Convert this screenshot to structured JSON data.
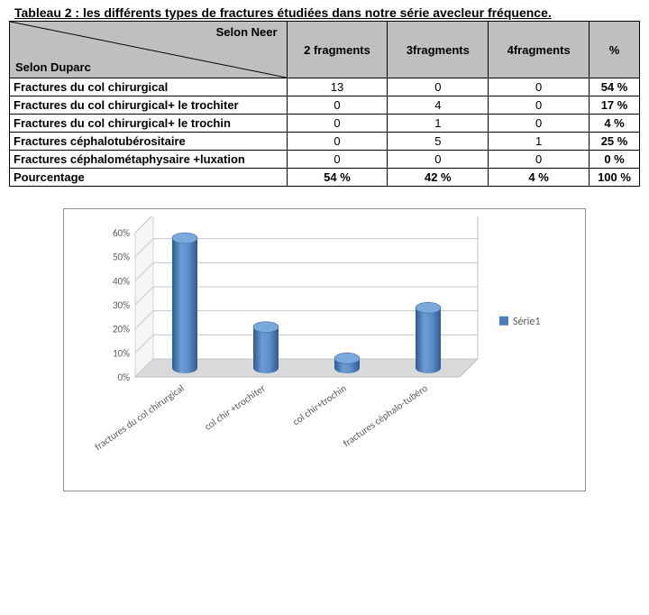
{
  "caption": "Tableau 2 :   les différents types de fractures étudiées dans notre série avecleur fréquence.",
  "table": {
    "top_axis": "Selon Neer",
    "left_axis": "Selon Duparc",
    "columns": [
      "2 fragments",
      "3fragments",
      "4fragments",
      "%"
    ],
    "rows": [
      {
        "label": "Fractures du col chirurgical",
        "cells": [
          "13",
          "0",
          "0",
          "54 %"
        ]
      },
      {
        "label": "Fractures du col chirurgical+ le trochiter",
        "cells": [
          "0",
          "4",
          "0",
          "17 %"
        ]
      },
      {
        "label": "Fractures du col chirurgical+ le trochin",
        "cells": [
          "0",
          "1",
          "0",
          "4 %"
        ]
      },
      {
        "label": "Fractures céphalotubérositaire",
        "cells": [
          "0",
          "5",
          "1",
          "25 %"
        ]
      },
      {
        "label": "Fractures céphalométaphysaire +luxation",
        "cells": [
          "0",
          "0",
          "0",
          "0 %"
        ]
      }
    ],
    "footer": {
      "label": "Pourcentage",
      "cells": [
        "54 %",
        "42 %",
        "4 %",
        "100 %"
      ]
    }
  },
  "chart_data": {
    "type": "bar",
    "title": "",
    "xlabel": "",
    "ylabel": "",
    "ylim": [
      0,
      0.6
    ],
    "ytick_labels": [
      "0%",
      "10%",
      "20%",
      "30%",
      "40%",
      "50%",
      "60%"
    ],
    "categories": [
      "fractures du col chirurgical",
      "col chir +trochiter",
      "col chir+trochin",
      "fractures céphalo-tubéro"
    ],
    "series": [
      {
        "name": "Série1",
        "values": [
          0.54,
          0.17,
          0.04,
          0.25
        ],
        "color": "#4a7ebb"
      }
    ],
    "legend_position": "right"
  }
}
